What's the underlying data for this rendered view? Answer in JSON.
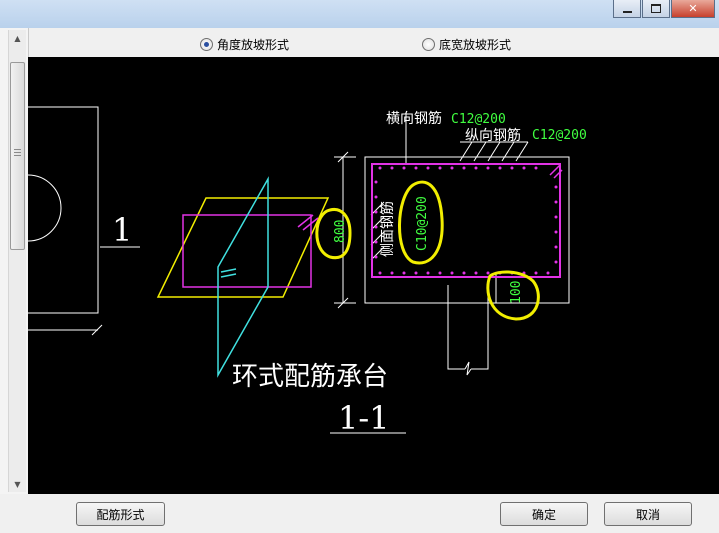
{
  "options": {
    "angle_slope": "角度放坡形式",
    "width_slope": "底宽放坡形式",
    "selected": "angle_slope"
  },
  "drawing": {
    "label_section_num": "1",
    "transverse_rebar_label": "横向钢筋",
    "transverse_rebar_spec": "C12@200",
    "longitudinal_rebar_label": "纵向钢筋",
    "longitudinal_rebar_spec": "C12@200",
    "side_rebar_label": "侧面钢筋",
    "side_rebar_spec": "C10@200",
    "height_dim": "800",
    "cover_dim": "100",
    "caption": "环式配筋承台",
    "section_title": "1-1",
    "colors": {
      "background": "#000000",
      "outline": "#ffffff",
      "rebar": "#e233e6",
      "dim": "#ffffff",
      "spec_text": "#40ff40",
      "highlight": "#f2ee00",
      "slope": "#f2ee00",
      "axis": "#40e0e0"
    }
  },
  "buttons": {
    "rebar_form": "配筋形式",
    "ok": "确定",
    "cancel": "取消"
  }
}
